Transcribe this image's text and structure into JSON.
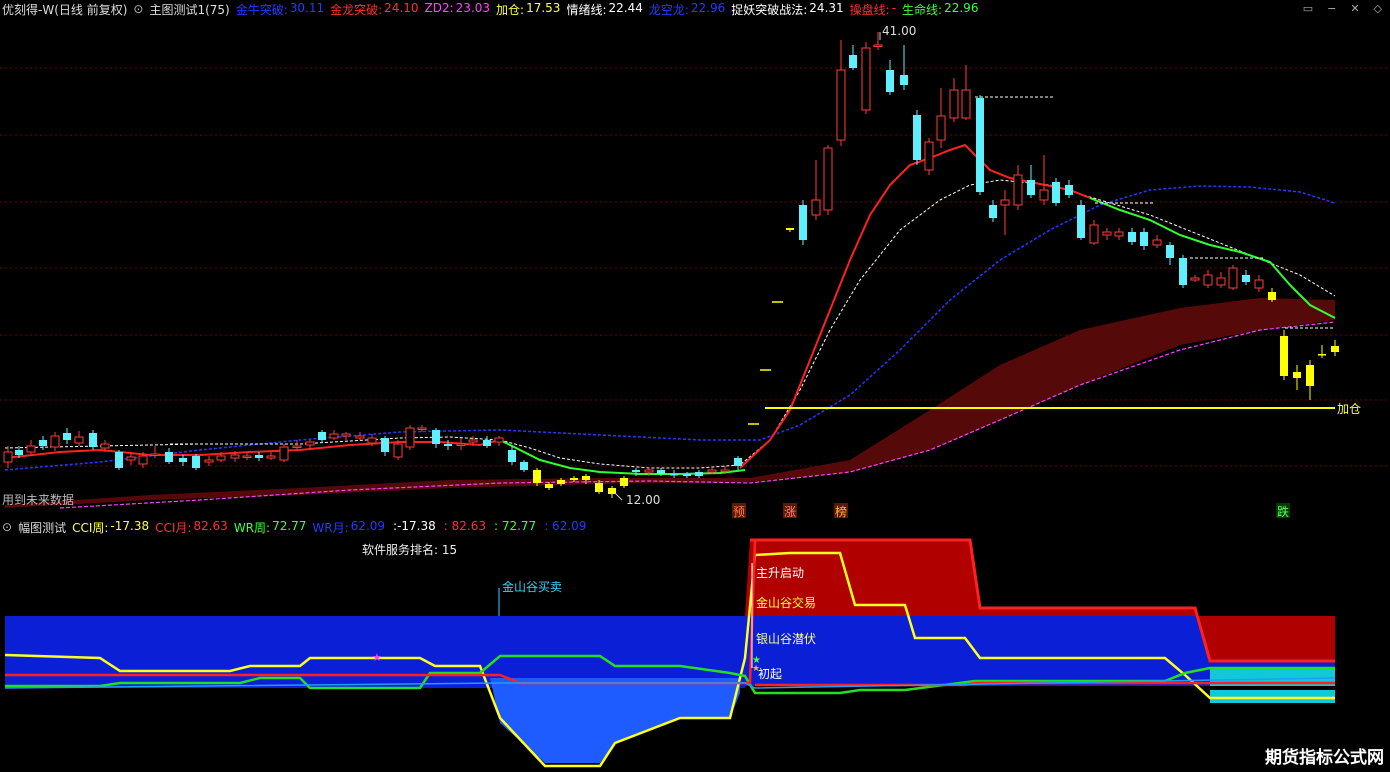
{
  "main": {
    "stock_label": "优刻得-W(日线 前复权)",
    "indicator_label": "主图测试1(75)",
    "items": [
      {
        "label": "金牛突破:",
        "value": "30.11",
        "color": "#1e3cff"
      },
      {
        "label": "金龙突破:",
        "value": "24.10",
        "color": "#ff3030"
      },
      {
        "label": "ZD2:",
        "value": "23.03",
        "color": "#ff40ff"
      },
      {
        "label": "加仓:",
        "value": "17.53",
        "color": "#ffff40"
      },
      {
        "label": "情绪线:",
        "value": "22.44",
        "color": "#ffffff"
      },
      {
        "label": "龙空龙:",
        "value": "22.96",
        "color": "#1e3cff"
      },
      {
        "label": "捉妖突破战法:",
        "value": "24.31",
        "color": "#ffffff"
      },
      {
        "label": "操盘线:",
        "value": "-",
        "color": "#ff3030"
      },
      {
        "label": "生命线:",
        "value": "22.96",
        "color": "#40ff40"
      }
    ],
    "high_label": "41.00",
    "low_label": "12.00",
    "jiacang_label": "加仓",
    "future_note": "用到未来数据",
    "badges": {
      "yu": "预",
      "zhang": "涨",
      "bang": "榜",
      "die": "跌"
    }
  },
  "sub": {
    "indicator_label": "幅图测试",
    "items": [
      {
        "label": "CCI周:",
        "value": "-17.38",
        "color": "#ffff40"
      },
      {
        "label": "CCI月:",
        "value": "82.63",
        "color": "#ff3030"
      },
      {
        "label": "WR周:",
        "value": "72.77",
        "color": "#40ff40"
      },
      {
        "label": "WR月:",
        "value": "62.09",
        "color": "#1e3cff"
      },
      {
        "label": "",
        "value": ":-17.38",
        "color": "#ffffff"
      },
      {
        "label": "",
        "value": ": 82.63",
        "color": "#ff3030"
      },
      {
        "label": "",
        "value": ": 72.77",
        "color": "#40ff40"
      },
      {
        "label": "",
        "value": ": 62.09",
        "color": "#1e3cff"
      }
    ],
    "rank_label": "软件服务排名:",
    "rank_value": "15",
    "annotations": {
      "jinshangu": "金山谷买卖",
      "zhusheng": "主升启动",
      "jinshangu_trade": "金山谷交易",
      "qianfu": "银山谷潜伏",
      "chuqi": "初起"
    }
  },
  "watermark": "期货指标公式网",
  "colors": {
    "up_candle": "#ff3b3b",
    "down_candle": "#5ff0ff",
    "yellow_candle": "#ffff00",
    "grid": "#8b0000",
    "background": "#000000"
  }
}
